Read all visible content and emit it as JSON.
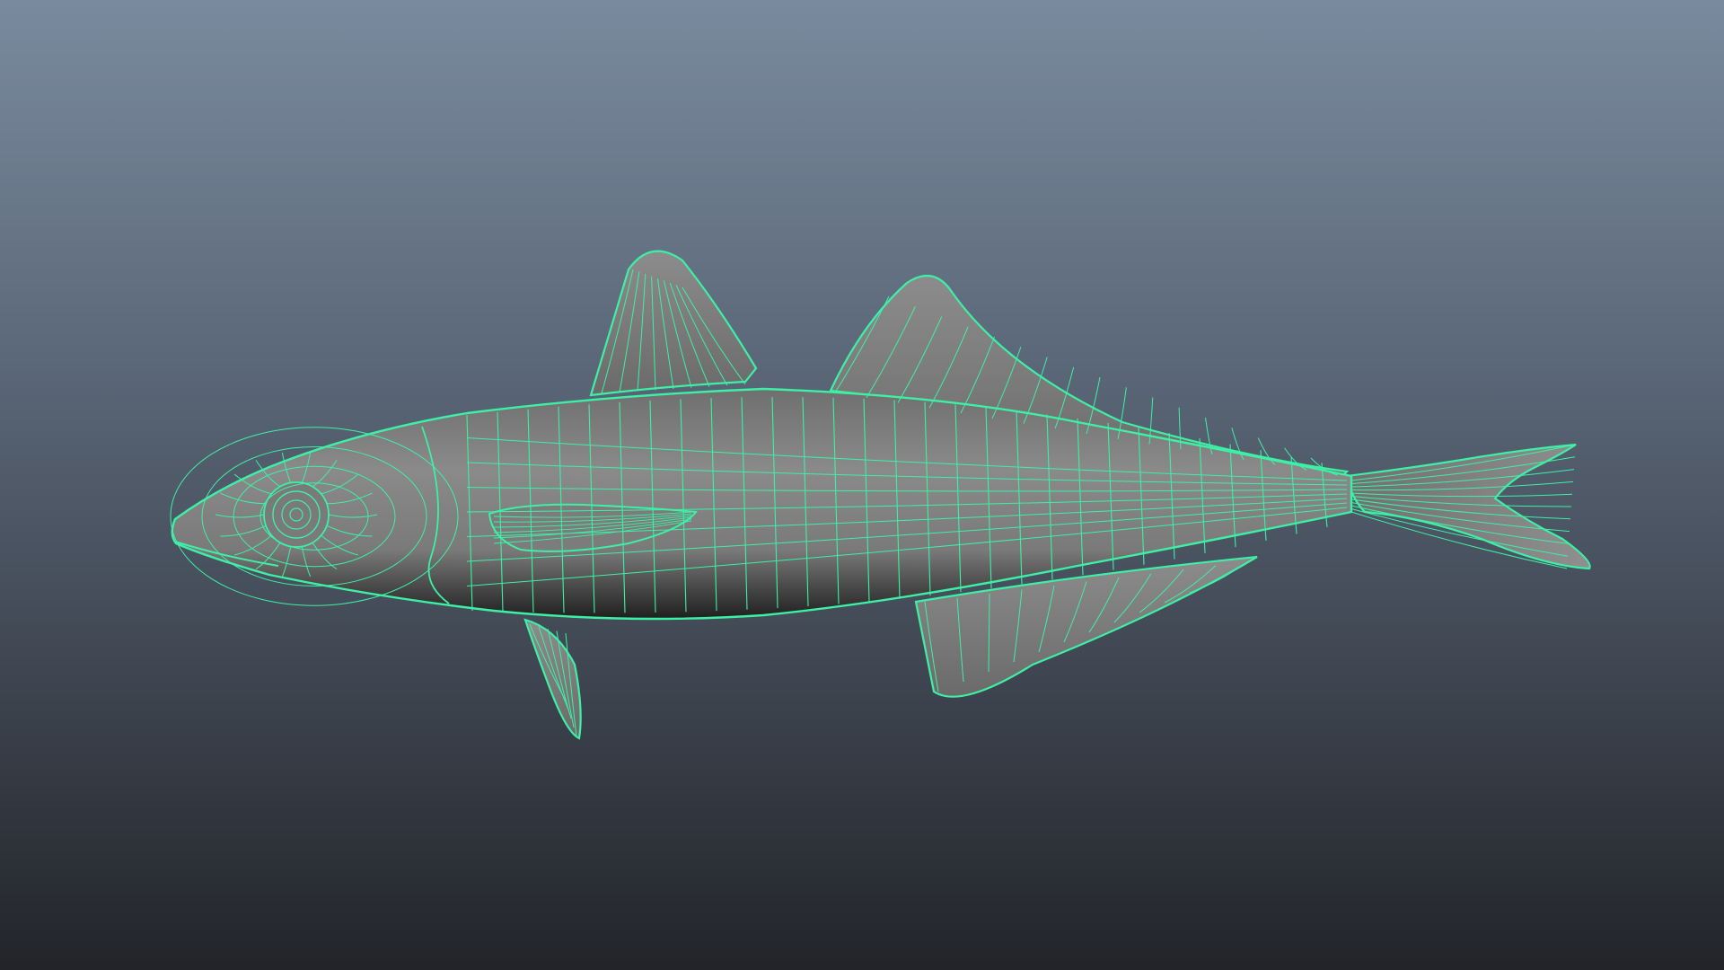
{
  "viewport": {
    "subject": "fish-wireframe-model",
    "background_top": "#7a8a9e",
    "background_bottom": "#222429",
    "wireframe_color": "#3df0a6",
    "surface_color": "#7f7f7f",
    "surface_highlight": "#9a9a9a",
    "surface_shadow": "#2a2a2a"
  }
}
